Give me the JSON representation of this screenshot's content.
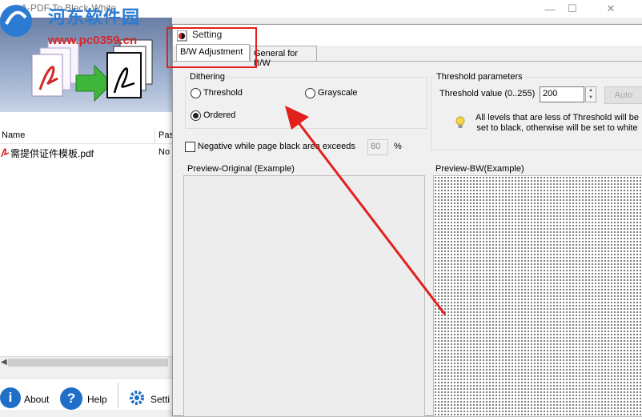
{
  "main": {
    "title": "A-PDF To Black-White",
    "list": {
      "headers": [
        "Name",
        "Pas"
      ],
      "rows": [
        {
          "name": "需提供证件模板.pdf",
          "pass": "No"
        }
      ]
    },
    "toolbar": {
      "about": "About",
      "help": "Help",
      "setting": "Setti"
    }
  },
  "watermark": {
    "line1": "河东软件园",
    "line2": "www.pc0359.cn"
  },
  "dialog": {
    "title": "Setting",
    "tabs": [
      "B/W Adjustment",
      "General for B/W"
    ],
    "dithering": {
      "label": "Dithering",
      "options": [
        "Threshold",
        "Grayscale",
        "Ordered"
      ],
      "selected": "Ordered"
    },
    "threshold": {
      "label": "Threshold parameters",
      "value_label": "Threshold value (0..255)",
      "value": "200",
      "auto_label": "Auto",
      "info": "All levels that are less of Threshold will be set to black, otherwise will be set to white"
    },
    "negative": {
      "label": "Negative while page black area exceeds",
      "value": "80",
      "unit": "%"
    },
    "preview": {
      "original_label": "Preview-Original (Example)",
      "bw_label": "Preview-BW(Example)"
    }
  },
  "colors": {
    "annotation_red": "#e2201c",
    "brand_blue": "#2b7bd2"
  }
}
